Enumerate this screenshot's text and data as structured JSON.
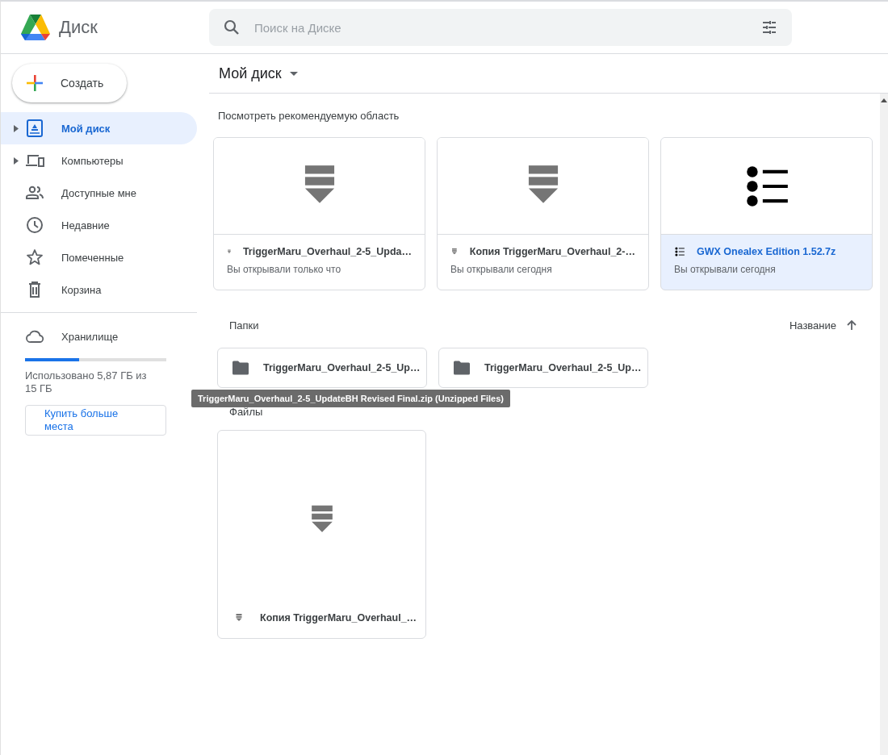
{
  "app": {
    "title": "Диск"
  },
  "search": {
    "placeholder": "Поиск на Диске"
  },
  "create_button": {
    "label": "Создать"
  },
  "sidebar": {
    "items": [
      {
        "kind": "drive",
        "label": "Мой диск",
        "expandable": true,
        "selected": true
      },
      {
        "kind": "computers",
        "label": "Компьютеры",
        "expandable": true,
        "selected": false
      },
      {
        "kind": "shared",
        "label": "Доступные мне",
        "expandable": false,
        "selected": false
      },
      {
        "kind": "recent",
        "label": "Недавние",
        "expandable": false,
        "selected": false
      },
      {
        "kind": "starred",
        "label": "Помеченные",
        "expandable": false,
        "selected": false
      },
      {
        "kind": "trash",
        "label": "Корзина",
        "expandable": false,
        "selected": false
      }
    ]
  },
  "storage": {
    "label": "Хранилище",
    "level": 0.38,
    "usage": "Использовано 5,87 ГБ из 15 ГБ",
    "button": "Купить больше места"
  },
  "breadcrumb": {
    "title": "Мой диск"
  },
  "quick_access": {
    "heading": "Посмотреть рекомендуемую область",
    "cards": [
      {
        "kind": "archive",
        "name": "TriggerMaru_Overhaul_2-5_Upda…",
        "subtitle": "Вы открывали только что",
        "selected": false
      },
      {
        "kind": "archive",
        "name": "Копия TriggerMaru_Overhaul_2-…",
        "subtitle": "Вы открывали сегодня",
        "selected": false
      },
      {
        "kind": "list",
        "name": "GWX Onealex Edition 1.52.7z",
        "subtitle": "Вы открывали сегодня",
        "selected": true
      }
    ]
  },
  "folders": {
    "heading": "Папки",
    "sort_label": "Название",
    "items": [
      {
        "name": "TriggerMaru_Overhaul_2-5_Up…"
      },
      {
        "name": "TriggerMaru_Overhaul_2-5_Up…"
      }
    ]
  },
  "tooltip": {
    "text": "TriggerMaru_Overhaul_2-5_UpdateBH Revised Final.zip (Unzipped Files)"
  },
  "files": {
    "heading": "Файлы",
    "items": [
      {
        "kind": "archive",
        "name": "Копия TriggerMaru_Overhaul_…"
      }
    ]
  }
}
